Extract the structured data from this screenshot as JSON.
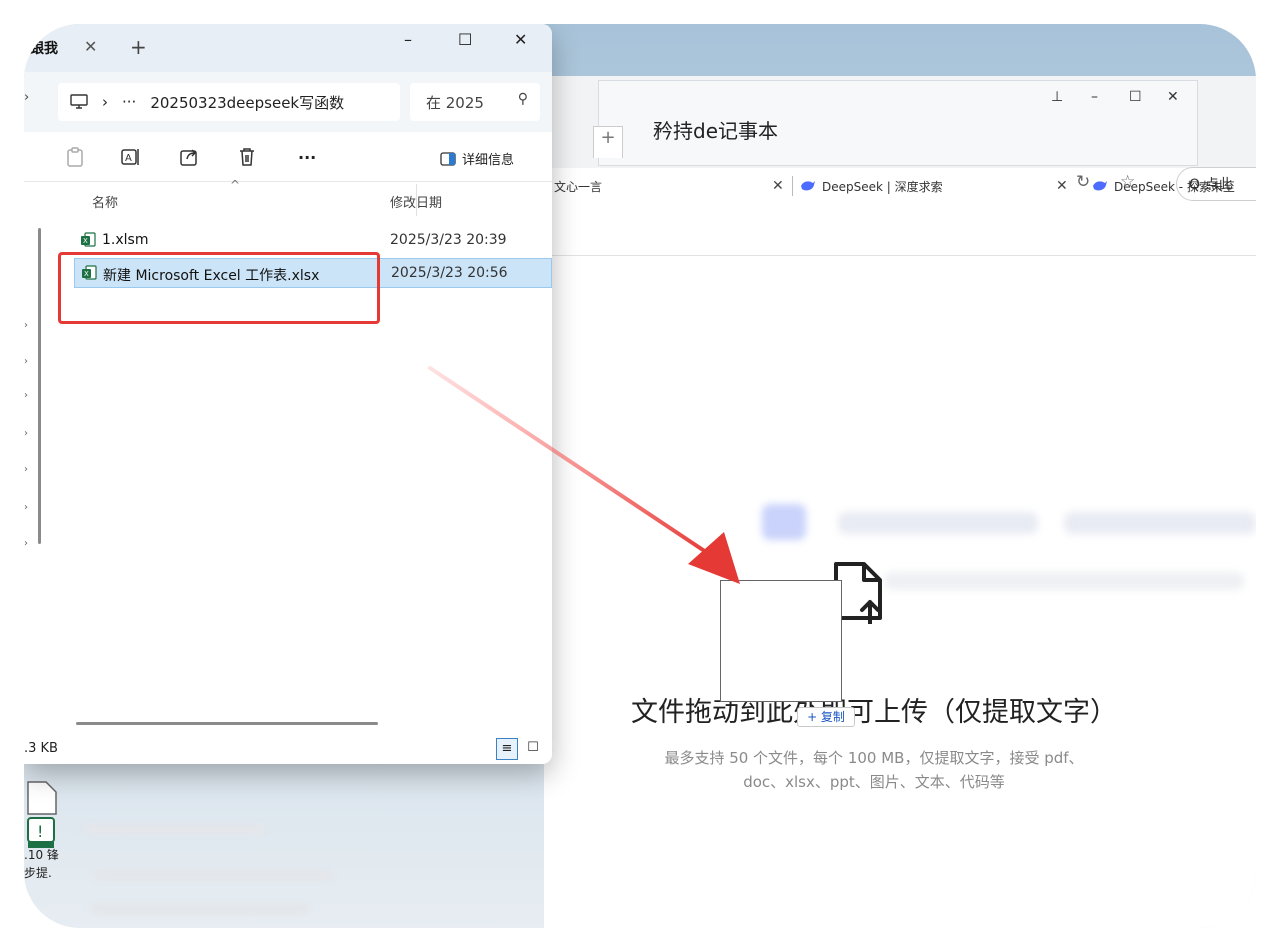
{
  "explorer": {
    "tab_title": "跟我",
    "tab_close": "✕",
    "new_tab": "+",
    "win_minimize": "–",
    "win_maximize": "☐",
    "win_close": "✕",
    "path_monitor": "🖵",
    "path_chevron": "›",
    "path_more": "···",
    "path_folder": "20250323deepseek写函数",
    "search_placeholder": "在 2025",
    "details_label": "详细信息",
    "more_label": "···",
    "col_name": "名称",
    "col_date": "修改日期",
    "sort_caret": "^",
    "files": [
      {
        "name": "1.xlsm",
        "date": "2025/3/23 20:39"
      },
      {
        "name": "新建 Microsoft Excel 工作表.xlsx",
        "date": "2025/3/23 20:56"
      }
    ],
    "status_size": ".3 KB",
    "view_details": "≡",
    "view_icons": "☐"
  },
  "browser": {
    "tab_partial": "文心一言",
    "tab_2": "DeepSeek | 深度求索",
    "tab_3": "DeepSeek - 探索未至",
    "tab_close": "✕",
    "search_text": "Q 点此",
    "refresh_icon": "↻",
    "star_icon": "☆"
  },
  "notepad": {
    "title": "矜持de记事本",
    "pin": "⊥",
    "minimize": "–",
    "maximize": "☐",
    "close": "✕",
    "dots": "···",
    "plus": "+",
    "side_text": "在 2025"
  },
  "upload": {
    "title": "文件拖动到此处即可上传（仅提取文字）",
    "subtitle_line1": "最多支持 50 个文件，每个 100 MB，仅提取文字，接受 pdf、",
    "subtitle_line2": "doc、xlsx、ppt、图片、文本、代码等",
    "copy_badge": "+ 复制"
  },
  "desktop": {
    "label_1": ".10 锋",
    "label_2": "步提."
  },
  "colors": {
    "accent_red": "#e53935",
    "selection": "#cce4f7",
    "excel_green": "#1d7044"
  }
}
